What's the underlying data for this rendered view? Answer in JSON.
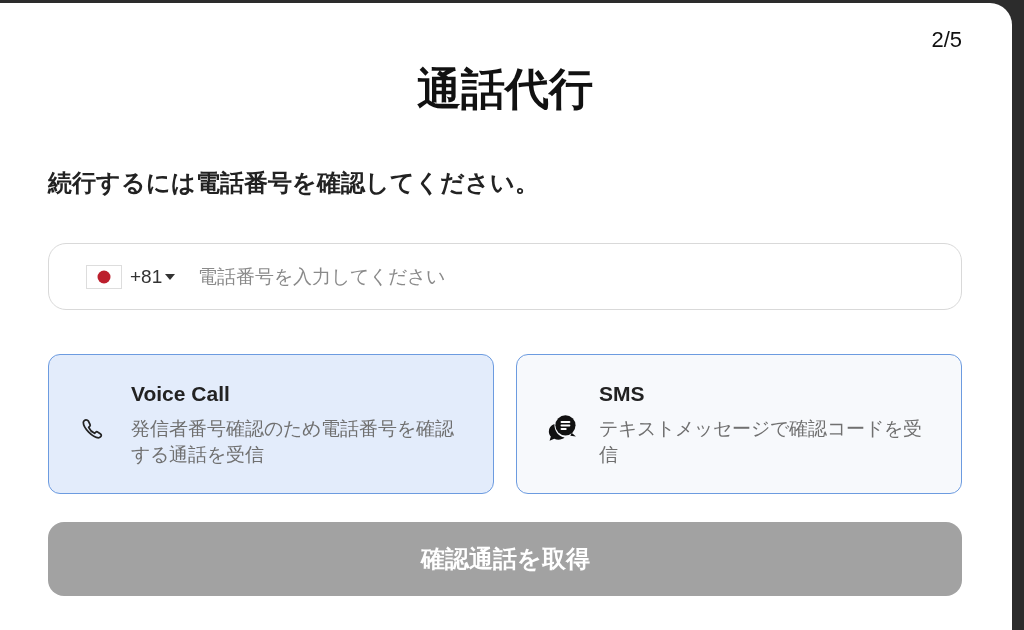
{
  "progress": "2/5",
  "title": "通話代行",
  "prompt": "続行するには電話番号を確認してください。",
  "phone_field": {
    "country_code": "+81",
    "placeholder": "電話番号を入力してください"
  },
  "methods": [
    {
      "kind": "voice",
      "title": "Voice Call",
      "description": "発信者番号確認のため電話番号を確認する通話を受信",
      "selected": true
    },
    {
      "kind": "sms",
      "title": "SMS",
      "description": "テキストメッセージで確認コードを受信",
      "selected": false
    }
  ],
  "submit_button": {
    "label": "確認通話を取得",
    "disabled": true
  }
}
